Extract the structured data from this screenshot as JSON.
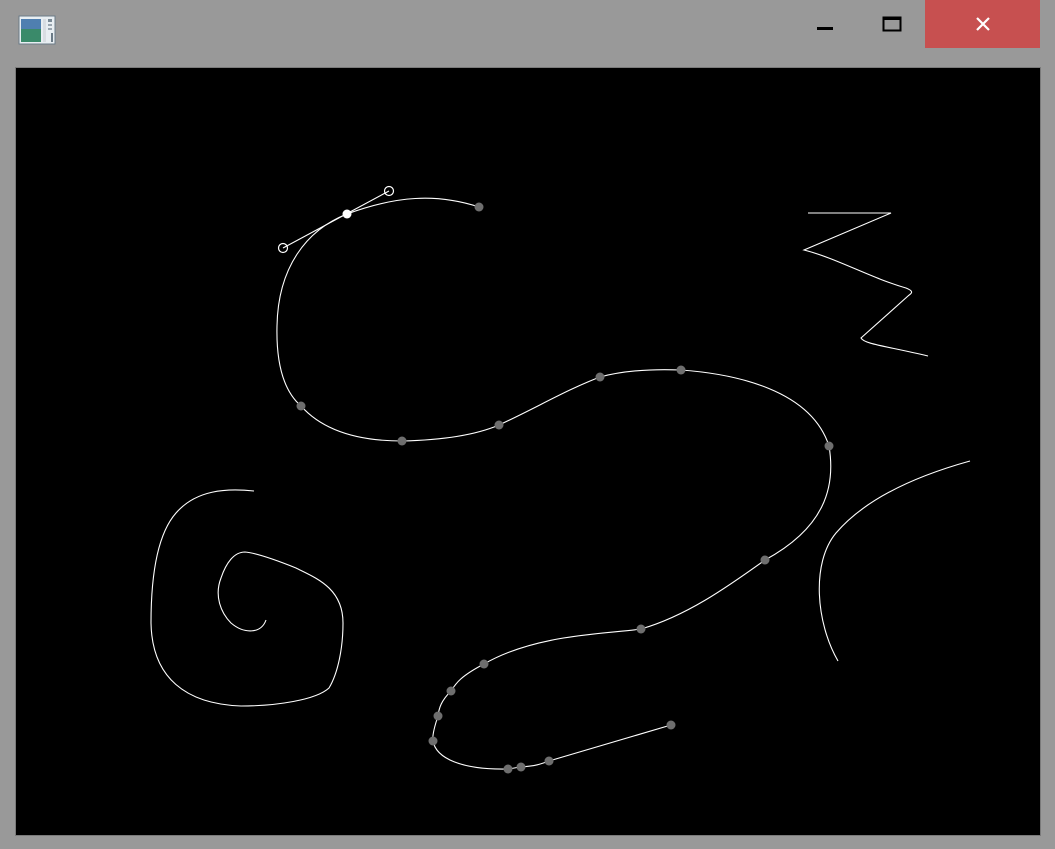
{
  "window": {
    "title": "",
    "icon": "application-icon",
    "controls": [
      {
        "name": "minimize-icon"
      },
      {
        "name": "maximize-icon"
      },
      {
        "name": "close-icon"
      }
    ],
    "colors": {
      "frame": "#999999",
      "close_hover": "#c75050",
      "canvas_background": "#000000",
      "stroke": "#ffffff",
      "control_point": "#6e6e6e",
      "selected_point": "#ffffff"
    }
  },
  "canvas": {
    "description_free": true,
    "curves": [
      {
        "id": "selected-bezier-curve",
        "selected": true
      },
      {
        "id": "long-s-curve",
        "control_points": 15
      },
      {
        "id": "zigzag-stroke"
      },
      {
        "id": "right-arc-stroke"
      },
      {
        "id": "spiral-stroke"
      }
    ]
  }
}
